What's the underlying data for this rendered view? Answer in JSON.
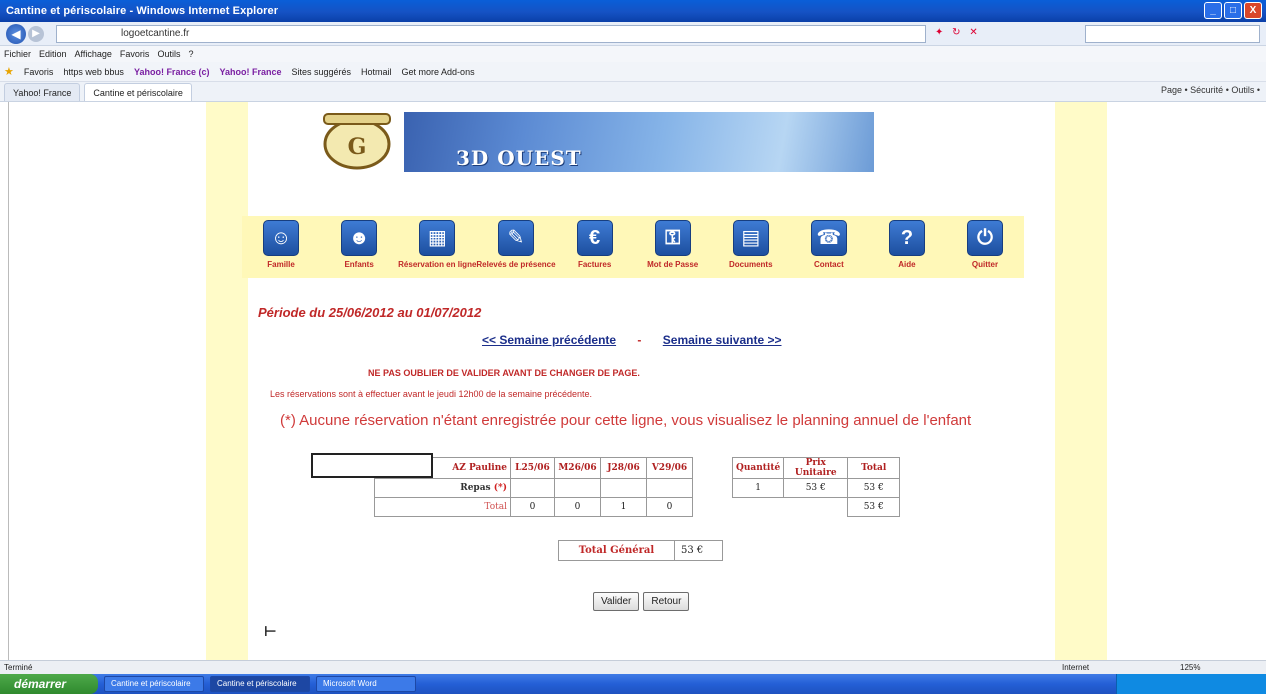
{
  "window": {
    "title": "Cantine et périscolaire - Windows Internet Explorer",
    "min": "_",
    "max": "□",
    "close": "X"
  },
  "address": {
    "url": "logoetcantine.fr"
  },
  "menu": [
    "Fichier",
    "Edition",
    "Affichage",
    "Favoris",
    "Outils",
    "?"
  ],
  "favorites": {
    "label": "Favoris",
    "items": [
      "https web bbus",
      "Yahoo! France (c)",
      "Yahoo! France",
      "Sites suggérés",
      "Hotmail",
      "Get more Add-ons"
    ]
  },
  "tabs": [
    {
      "label": "Yahoo! France"
    },
    {
      "label": "Cantine et périscolaire"
    }
  ],
  "tab_tools": "Page • Sécurité • Outils •",
  "banner": {
    "title": "3D OUEST"
  },
  "nav": [
    {
      "label": "Famille",
      "icon": "family-icon"
    },
    {
      "label": "Enfants",
      "icon": "children-icon"
    },
    {
      "label": "Réservation en ligne",
      "icon": "calendar-icon"
    },
    {
      "label": "Relevés de présence",
      "icon": "attendance-icon"
    },
    {
      "label": "Factures",
      "icon": "invoice-icon"
    },
    {
      "label": "Mot de Passe",
      "icon": "password-icon"
    },
    {
      "label": "Documents",
      "icon": "documents-icon"
    },
    {
      "label": "Contact",
      "icon": "phone-icon"
    },
    {
      "label": "Aide",
      "icon": "help-icon"
    },
    {
      "label": "Quitter",
      "icon": "power-icon"
    }
  ],
  "period": "Période du 25/06/2012 au 01/07/2012",
  "weeknav": {
    "prev": "<< Semaine précédente",
    "sep": "-",
    "next": "Semaine suivante >>"
  },
  "warning": "NE PAS OUBLIER DE VALIDER AVANT DE CHANGER DE PAGE.",
  "note": "Les réservations sont à effectuer avant le jeudi 12h00 de la semaine précédente.",
  "info": "(*) Aucune réservation n'étant enregistrée pour cette ligne, vous visualisez le planning annuel de l'enfant",
  "table": {
    "child": "AZ Pauline",
    "days": [
      "L25/06",
      "M26/06",
      "J28/06",
      "V29/06"
    ],
    "headers": {
      "quantity": "Quantité",
      "unit_price": "Prix Unitaire",
      "total": "Total"
    },
    "row": {
      "label": "Repas",
      "star": "(*)",
      "days": [
        "",
        "",
        "",
        ""
      ],
      "quantity": "1",
      "unit_price": "53 €",
      "total": "53 €"
    },
    "totals": {
      "label": "Total",
      "days": [
        "0",
        "0",
        "1",
        "0"
      ],
      "total": "53 €"
    }
  },
  "grand_total": {
    "label": "Total Général",
    "value": "53 €"
  },
  "buttons": {
    "validate": "Valider",
    "back": "Retour"
  },
  "status": {
    "left": "Terminé",
    "zone": "Internet",
    "zoom": "125%"
  },
  "taskbar": {
    "start": "démarrer",
    "tasks": [
      "Cantine et périscolaire",
      "Cantine et périscolaire",
      "Microsoft Word"
    ]
  }
}
